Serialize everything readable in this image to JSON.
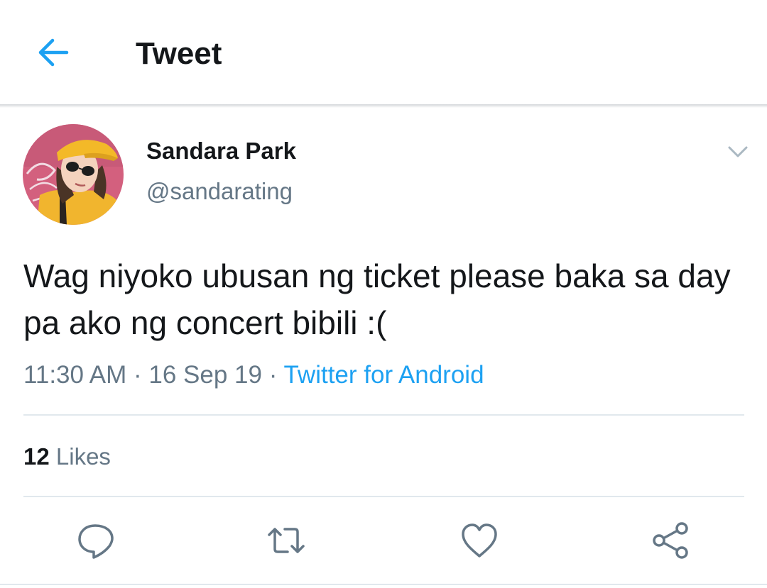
{
  "header": {
    "back_icon": "arrow-left-icon",
    "title": "Tweet"
  },
  "tweet": {
    "author_name": "Sandara Park",
    "author_handle": "@sandarating",
    "menu_icon": "chevron-down-icon",
    "text": "Wag niyoko ubusan ng ticket please baka sa day pa ako ng concert bibili :(",
    "time": "11:30 AM",
    "separator": " · ",
    "date": "16 Sep 19",
    "source": "Twitter for Android",
    "likes_count": "12",
    "likes_label": " Likes"
  },
  "actions": [
    {
      "name": "reply",
      "icon": "comment-icon"
    },
    {
      "name": "retweet",
      "icon": "retweet-icon"
    },
    {
      "name": "like",
      "icon": "heart-icon"
    },
    {
      "name": "share",
      "icon": "share-icon"
    }
  ],
  "colors": {
    "accent": "#1da1f2",
    "text_primary": "#14171a",
    "text_secondary": "#657786",
    "divider": "#e1e8ed"
  }
}
